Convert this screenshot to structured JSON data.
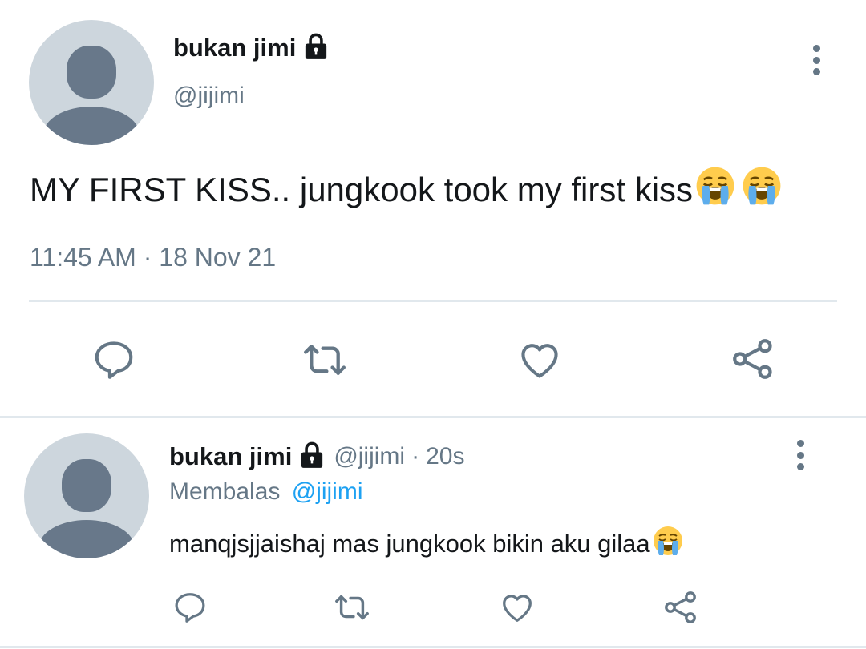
{
  "main_tweet": {
    "display_name": "bukan jimi",
    "handle": "@jijimi",
    "text": "MY FIRST KISS.. jungkook took my first kiss",
    "emojis": [
      "loudly-crying-face-emoji",
      "loudly-crying-face-emoji"
    ],
    "timestamp": "11:45 AM · 18 Nov 21",
    "actions": [
      "reply-icon",
      "retweet-icon",
      "like-icon",
      "share-icon"
    ]
  },
  "reply_tweet": {
    "display_name": "bukan jimi",
    "handle": "@jijimi",
    "separator": "·",
    "time_ago": "20s",
    "replying_to_label": "Membalas",
    "replying_to_handle": "@jijimi",
    "text": "manqjsjjaishaj mas jungkook bikin aku gilaa",
    "emojis": [
      "loudly-crying-face-emoji"
    ],
    "actions": [
      "reply-icon",
      "retweet-icon",
      "like-icon",
      "share-icon"
    ]
  },
  "colors": {
    "text": "#14171a",
    "muted": "#657786",
    "link": "#1da1f2",
    "avatar_bg": "#cdd6dd",
    "avatar_fg": "#68788a",
    "divider": "#e1e8ed"
  }
}
